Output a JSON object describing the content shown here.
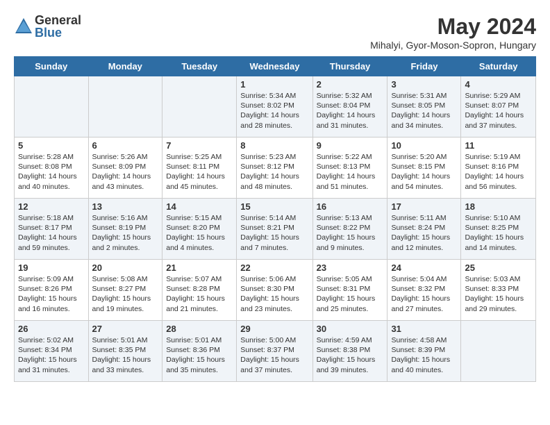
{
  "logo": {
    "general": "General",
    "blue": "Blue"
  },
  "title": {
    "month": "May 2024",
    "location": "Mihalyi, Gyor-Moson-Sopron, Hungary"
  },
  "days_header": [
    "Sunday",
    "Monday",
    "Tuesday",
    "Wednesday",
    "Thursday",
    "Friday",
    "Saturday"
  ],
  "weeks": [
    [
      {
        "day": "",
        "info": ""
      },
      {
        "day": "",
        "info": ""
      },
      {
        "day": "",
        "info": ""
      },
      {
        "day": "1",
        "info": "Sunrise: 5:34 AM\nSunset: 8:02 PM\nDaylight: 14 hours\nand 28 minutes."
      },
      {
        "day": "2",
        "info": "Sunrise: 5:32 AM\nSunset: 8:04 PM\nDaylight: 14 hours\nand 31 minutes."
      },
      {
        "day": "3",
        "info": "Sunrise: 5:31 AM\nSunset: 8:05 PM\nDaylight: 14 hours\nand 34 minutes."
      },
      {
        "day": "4",
        "info": "Sunrise: 5:29 AM\nSunset: 8:07 PM\nDaylight: 14 hours\nand 37 minutes."
      }
    ],
    [
      {
        "day": "5",
        "info": "Sunrise: 5:28 AM\nSunset: 8:08 PM\nDaylight: 14 hours\nand 40 minutes."
      },
      {
        "day": "6",
        "info": "Sunrise: 5:26 AM\nSunset: 8:09 PM\nDaylight: 14 hours\nand 43 minutes."
      },
      {
        "day": "7",
        "info": "Sunrise: 5:25 AM\nSunset: 8:11 PM\nDaylight: 14 hours\nand 45 minutes."
      },
      {
        "day": "8",
        "info": "Sunrise: 5:23 AM\nSunset: 8:12 PM\nDaylight: 14 hours\nand 48 minutes."
      },
      {
        "day": "9",
        "info": "Sunrise: 5:22 AM\nSunset: 8:13 PM\nDaylight: 14 hours\nand 51 minutes."
      },
      {
        "day": "10",
        "info": "Sunrise: 5:20 AM\nSunset: 8:15 PM\nDaylight: 14 hours\nand 54 minutes."
      },
      {
        "day": "11",
        "info": "Sunrise: 5:19 AM\nSunset: 8:16 PM\nDaylight: 14 hours\nand 56 minutes."
      }
    ],
    [
      {
        "day": "12",
        "info": "Sunrise: 5:18 AM\nSunset: 8:17 PM\nDaylight: 14 hours\nand 59 minutes."
      },
      {
        "day": "13",
        "info": "Sunrise: 5:16 AM\nSunset: 8:19 PM\nDaylight: 15 hours\nand 2 minutes."
      },
      {
        "day": "14",
        "info": "Sunrise: 5:15 AM\nSunset: 8:20 PM\nDaylight: 15 hours\nand 4 minutes."
      },
      {
        "day": "15",
        "info": "Sunrise: 5:14 AM\nSunset: 8:21 PM\nDaylight: 15 hours\nand 7 minutes."
      },
      {
        "day": "16",
        "info": "Sunrise: 5:13 AM\nSunset: 8:22 PM\nDaylight: 15 hours\nand 9 minutes."
      },
      {
        "day": "17",
        "info": "Sunrise: 5:11 AM\nSunset: 8:24 PM\nDaylight: 15 hours\nand 12 minutes."
      },
      {
        "day": "18",
        "info": "Sunrise: 5:10 AM\nSunset: 8:25 PM\nDaylight: 15 hours\nand 14 minutes."
      }
    ],
    [
      {
        "day": "19",
        "info": "Sunrise: 5:09 AM\nSunset: 8:26 PM\nDaylight: 15 hours\nand 16 minutes."
      },
      {
        "day": "20",
        "info": "Sunrise: 5:08 AM\nSunset: 8:27 PM\nDaylight: 15 hours\nand 19 minutes."
      },
      {
        "day": "21",
        "info": "Sunrise: 5:07 AM\nSunset: 8:28 PM\nDaylight: 15 hours\nand 21 minutes."
      },
      {
        "day": "22",
        "info": "Sunrise: 5:06 AM\nSunset: 8:30 PM\nDaylight: 15 hours\nand 23 minutes."
      },
      {
        "day": "23",
        "info": "Sunrise: 5:05 AM\nSunset: 8:31 PM\nDaylight: 15 hours\nand 25 minutes."
      },
      {
        "day": "24",
        "info": "Sunrise: 5:04 AM\nSunset: 8:32 PM\nDaylight: 15 hours\nand 27 minutes."
      },
      {
        "day": "25",
        "info": "Sunrise: 5:03 AM\nSunset: 8:33 PM\nDaylight: 15 hours\nand 29 minutes."
      }
    ],
    [
      {
        "day": "26",
        "info": "Sunrise: 5:02 AM\nSunset: 8:34 PM\nDaylight: 15 hours\nand 31 minutes."
      },
      {
        "day": "27",
        "info": "Sunrise: 5:01 AM\nSunset: 8:35 PM\nDaylight: 15 hours\nand 33 minutes."
      },
      {
        "day": "28",
        "info": "Sunrise: 5:01 AM\nSunset: 8:36 PM\nDaylight: 15 hours\nand 35 minutes."
      },
      {
        "day": "29",
        "info": "Sunrise: 5:00 AM\nSunset: 8:37 PM\nDaylight: 15 hours\nand 37 minutes."
      },
      {
        "day": "30",
        "info": "Sunrise: 4:59 AM\nSunset: 8:38 PM\nDaylight: 15 hours\nand 39 minutes."
      },
      {
        "day": "31",
        "info": "Sunrise: 4:58 AM\nSunset: 8:39 PM\nDaylight: 15 hours\nand 40 minutes."
      },
      {
        "day": "",
        "info": ""
      }
    ]
  ]
}
